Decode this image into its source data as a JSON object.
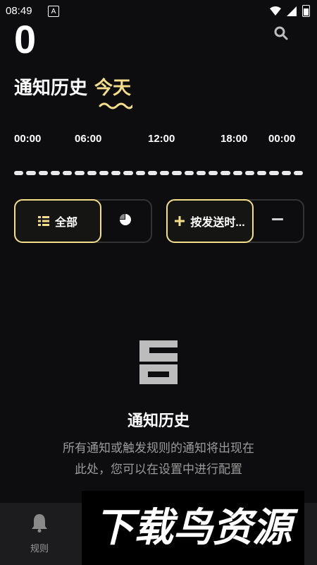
{
  "status_bar": {
    "time": "08:49",
    "notification_glyph": "A",
    "icons": [
      "wifi-icon",
      "signal-icon",
      "battery-icon"
    ]
  },
  "header": {
    "count": "0",
    "title": "通知历史",
    "period": "今天",
    "search_icon": "search-icon"
  },
  "timeline": {
    "ticks": [
      "00:00",
      "06:00",
      "12:00",
      "18:00",
      "00:00"
    ],
    "segments": 24
  },
  "filters": {
    "all_label": "全部",
    "all_icon": "list-icon",
    "chart_icon": "pie-chart-icon",
    "sort_label": "按发送时...",
    "add_icon": "plus-icon",
    "remove_icon": "minus-icon"
  },
  "empty_state": {
    "icon": "history-document-icon",
    "title": "通知历史",
    "description_line1": "所有通知或触发规则的通知将出现在",
    "description_line2": "此处，您可以在设置中进行配置"
  },
  "bottom_nav": {
    "rules_label": "规则",
    "rules_icon": "bell-icon"
  },
  "watermark": {
    "text": "下载鸟资源"
  },
  "colors": {
    "accent": "#f5de8a",
    "background": "#0d0d0f",
    "muted_text": "#9a9a9a",
    "nav_bg": "#1c1c1e"
  }
}
